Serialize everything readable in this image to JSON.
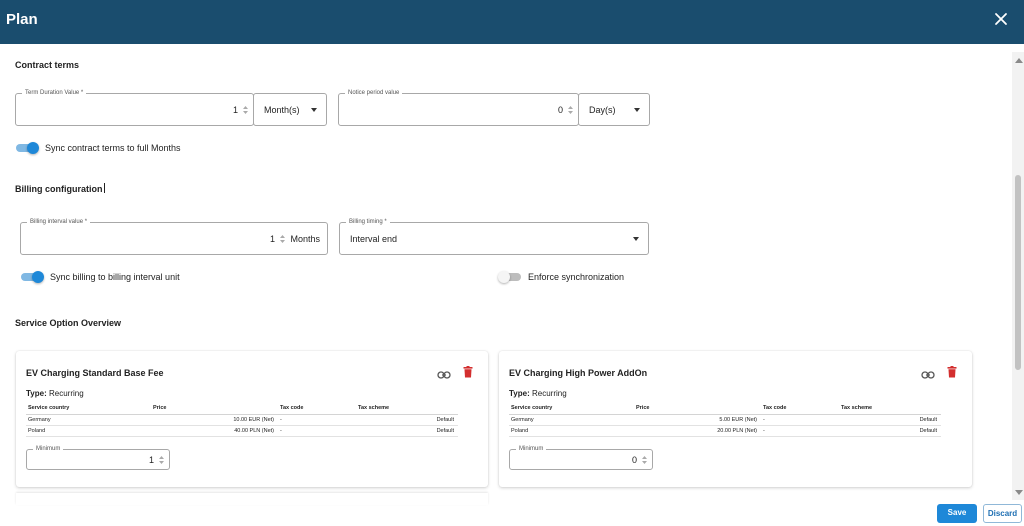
{
  "dialog": {
    "title": "Plan",
    "close_icon": "close-icon"
  },
  "contract": {
    "section_title": "Contract terms",
    "term": {
      "label": "Term Duration Value *",
      "value": "1",
      "unit": "Month(s)"
    },
    "notice": {
      "label": "Notice period value",
      "value": "0",
      "unit": "Day(s)"
    },
    "sync": {
      "label": "Sync contract terms to full Months",
      "on": true
    }
  },
  "billing": {
    "section_title": "Billing configuration",
    "interval": {
      "label": "Billing interval value *",
      "value": "1",
      "unit": "Months"
    },
    "timing": {
      "label": "Billing timing *",
      "value": "Interval end"
    },
    "sync": {
      "label": "Sync billing to billing interval unit",
      "on": true
    },
    "enforce": {
      "label": "Enforce synchronization",
      "on": false
    }
  },
  "services": {
    "section_title": "Service Option Overview",
    "columns": [
      "Service country",
      "Price",
      "Tax code",
      "Tax scheme"
    ],
    "cards": [
      {
        "title": "EV Charging Standard Base Fee",
        "type_label": "Type:",
        "type_value": "Recurring",
        "rows": [
          {
            "country": "Germany",
            "price": "10.00 EUR (Net)",
            "tax_code": "-",
            "tax_scheme": "Default"
          },
          {
            "country": "Poland",
            "price": "40.00 PLN (Net)",
            "tax_code": "-",
            "tax_scheme": "Default"
          }
        ],
        "minimum_label": "Minimum",
        "minimum_value": "1"
      },
      {
        "title": "EV Charging High Power AddOn",
        "type_label": "Type:",
        "type_value": "Recurring",
        "rows": [
          {
            "country": "Germany",
            "price": "5.00 EUR (Net)",
            "tax_code": "-",
            "tax_scheme": "Default"
          },
          {
            "country": "Poland",
            "price": "20.00 PLN (Net)",
            "tax_code": "-",
            "tax_scheme": "Default"
          }
        ],
        "minimum_label": "Minimum",
        "minimum_value": "0"
      }
    ]
  },
  "footer": {
    "save_label": "Save",
    "discard_label": "Discard"
  },
  "colors": {
    "header": "#1a4d6e",
    "accent": "#1e88d8",
    "delete": "#d32f2f"
  }
}
